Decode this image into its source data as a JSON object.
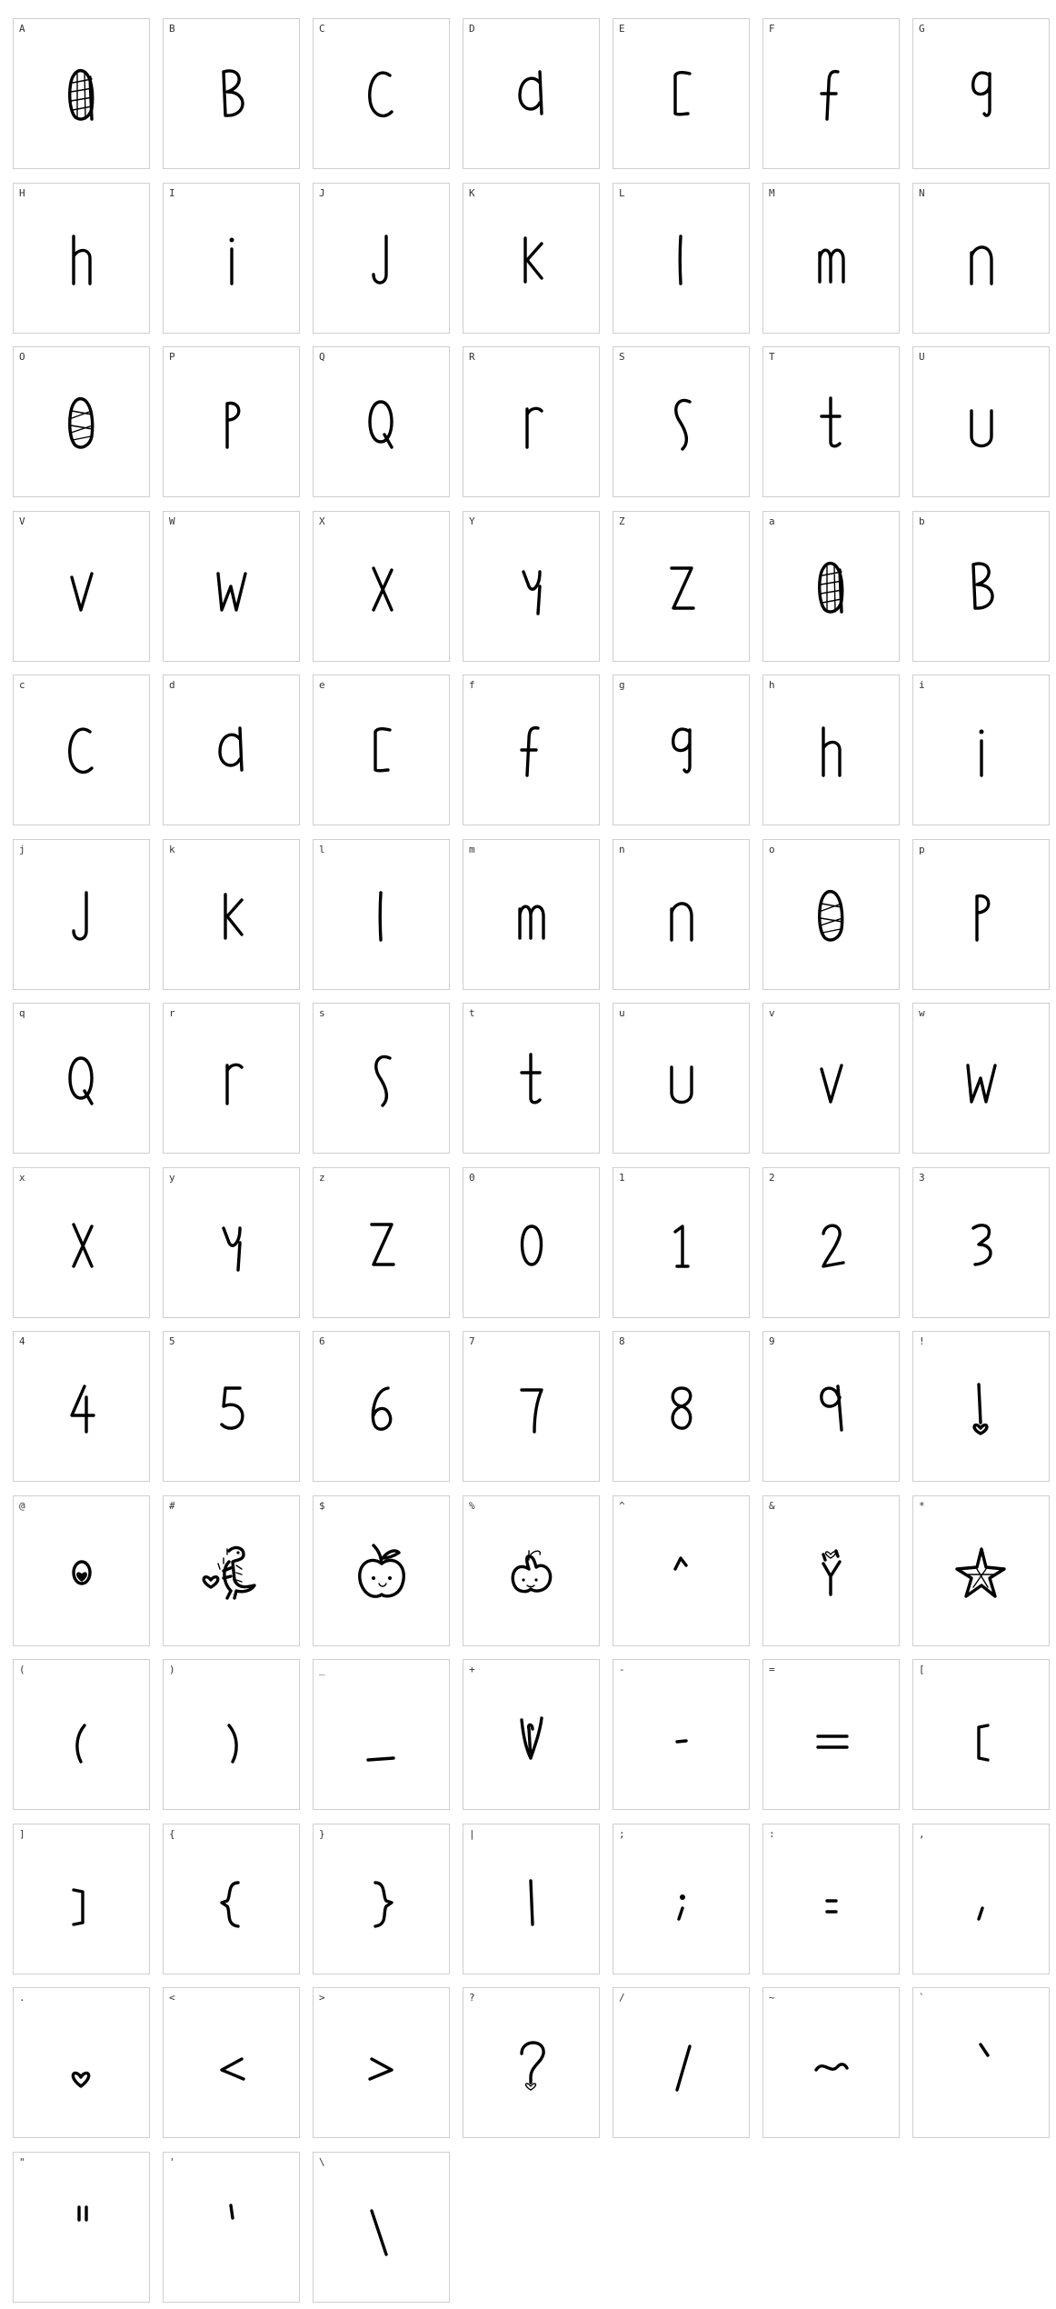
{
  "glyphs": [
    {
      "label": "A",
      "shape": "patterned-oval"
    },
    {
      "label": "B",
      "shape": "B"
    },
    {
      "label": "C",
      "shape": "C"
    },
    {
      "label": "D",
      "shape": "a-round"
    },
    {
      "label": "E",
      "shape": "E-bracket"
    },
    {
      "label": "F",
      "shape": "f"
    },
    {
      "label": "G",
      "shape": "g9"
    },
    {
      "label": "H",
      "shape": "h"
    },
    {
      "label": "I",
      "shape": "i"
    },
    {
      "label": "J",
      "shape": "J"
    },
    {
      "label": "K",
      "shape": "K"
    },
    {
      "label": "L",
      "shape": "l"
    },
    {
      "label": "M",
      "shape": "m"
    },
    {
      "label": "N",
      "shape": "n"
    },
    {
      "label": "O",
      "shape": "patterned-oval-2"
    },
    {
      "label": "P",
      "shape": "P"
    },
    {
      "label": "Q",
      "shape": "Q"
    },
    {
      "label": "R",
      "shape": "r"
    },
    {
      "label": "S",
      "shape": "S"
    },
    {
      "label": "T",
      "shape": "t"
    },
    {
      "label": "U",
      "shape": "U"
    },
    {
      "label": "V",
      "shape": "V"
    },
    {
      "label": "W",
      "shape": "W"
    },
    {
      "label": "X",
      "shape": "X"
    },
    {
      "label": "Y",
      "shape": "Y"
    },
    {
      "label": "Z",
      "shape": "Z"
    },
    {
      "label": "a",
      "shape": "patterned-oval"
    },
    {
      "label": "b",
      "shape": "B"
    },
    {
      "label": "c",
      "shape": "C"
    },
    {
      "label": "d",
      "shape": "a-round"
    },
    {
      "label": "e",
      "shape": "E-bracket"
    },
    {
      "label": "f",
      "shape": "f"
    },
    {
      "label": "g",
      "shape": "g9"
    },
    {
      "label": "h",
      "shape": "h"
    },
    {
      "label": "i",
      "shape": "i"
    },
    {
      "label": "j",
      "shape": "J"
    },
    {
      "label": "k",
      "shape": "K"
    },
    {
      "label": "l",
      "shape": "l"
    },
    {
      "label": "m",
      "shape": "m"
    },
    {
      "label": "n",
      "shape": "n"
    },
    {
      "label": "o",
      "shape": "patterned-oval-2"
    },
    {
      "label": "p",
      "shape": "P"
    },
    {
      "label": "q",
      "shape": "Q"
    },
    {
      "label": "r",
      "shape": "r"
    },
    {
      "label": "s",
      "shape": "S"
    },
    {
      "label": "t",
      "shape": "t"
    },
    {
      "label": "u",
      "shape": "U"
    },
    {
      "label": "v",
      "shape": "V"
    },
    {
      "label": "w",
      "shape": "W"
    },
    {
      "label": "x",
      "shape": "X"
    },
    {
      "label": "y",
      "shape": "Y"
    },
    {
      "label": "z",
      "shape": "Z"
    },
    {
      "label": "0",
      "shape": "zero"
    },
    {
      "label": "1",
      "shape": "one"
    },
    {
      "label": "2",
      "shape": "two"
    },
    {
      "label": "3",
      "shape": "three"
    },
    {
      "label": "4",
      "shape": "four"
    },
    {
      "label": "5",
      "shape": "five"
    },
    {
      "label": "6",
      "shape": "six"
    },
    {
      "label": "7",
      "shape": "seven"
    },
    {
      "label": "8",
      "shape": "eight"
    },
    {
      "label": "9",
      "shape": "nine"
    },
    {
      "label": "!",
      "shape": "exclaim-heart"
    },
    {
      "label": "@",
      "shape": "at-heart"
    },
    {
      "label": "#",
      "shape": "dinosaur"
    },
    {
      "label": "$",
      "shape": "apple-face"
    },
    {
      "label": "%",
      "shape": "apple-face-small"
    },
    {
      "label": "^",
      "shape": "caret"
    },
    {
      "label": "&",
      "shape": "ampersand-heart"
    },
    {
      "label": "*",
      "shape": "star"
    },
    {
      "label": "(",
      "shape": "paren-left"
    },
    {
      "label": ")",
      "shape": "paren-right"
    },
    {
      "label": "_",
      "shape": "underscore"
    },
    {
      "label": "+",
      "shape": "plus-heart"
    },
    {
      "label": "-",
      "shape": "dash"
    },
    {
      "label": "=",
      "shape": "equals"
    },
    {
      "label": "[",
      "shape": "bracket-left"
    },
    {
      "label": "]",
      "shape": "bracket-right"
    },
    {
      "label": "{",
      "shape": "brace-left"
    },
    {
      "label": "}",
      "shape": "brace-right"
    },
    {
      "label": "|",
      "shape": "bar"
    },
    {
      "label": ";",
      "shape": "semicolon"
    },
    {
      "label": ":",
      "shape": "colon"
    },
    {
      "label": ",",
      "shape": "comma"
    },
    {
      "label": ".",
      "shape": "period-heart"
    },
    {
      "label": "<",
      "shape": "less"
    },
    {
      "label": ">",
      "shape": "greater"
    },
    {
      "label": "?",
      "shape": "question"
    },
    {
      "label": "/",
      "shape": "slash"
    },
    {
      "label": "~",
      "shape": "tilde"
    },
    {
      "label": "`",
      "shape": "backtick"
    },
    {
      "label": "\"",
      "shape": "dquote"
    },
    {
      "label": "'",
      "shape": "squote"
    },
    {
      "label": "\\",
      "shape": "backslash"
    }
  ]
}
